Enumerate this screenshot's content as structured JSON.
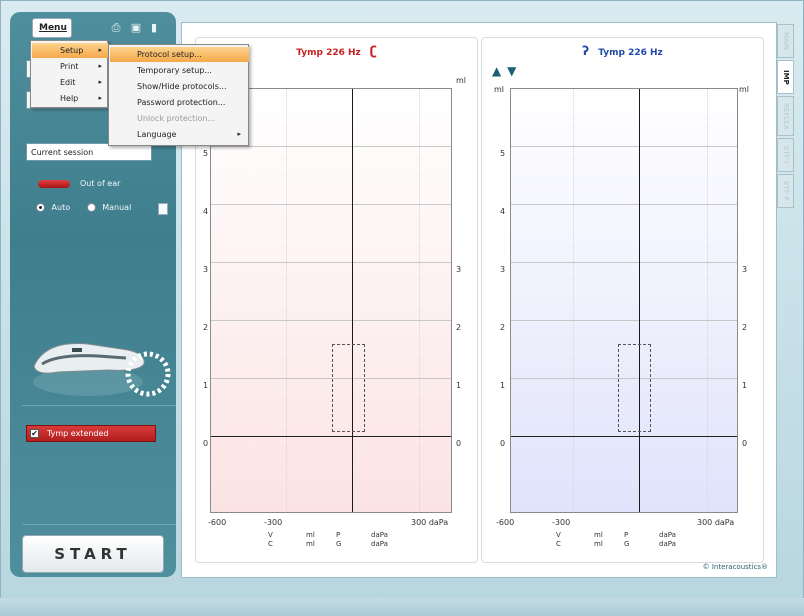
{
  "toolbar": {
    "menu_label": "Menu",
    "icons": [
      "printer-icon",
      "save-icon",
      "door-icon"
    ]
  },
  "menu": {
    "items": [
      {
        "label": "Setup",
        "has_submenu": true,
        "highlighted": true
      },
      {
        "label": "Print",
        "has_submenu": true
      },
      {
        "label": "Edit",
        "has_submenu": true
      },
      {
        "label": "Help",
        "has_submenu": true
      }
    ],
    "arrow": "▸"
  },
  "setup_submenu": {
    "items": [
      {
        "label": "Protocol setup...",
        "highlighted": true
      },
      {
        "label": "Temporary setup..."
      },
      {
        "label": "Show/Hide protocols..."
      },
      {
        "label": "Password protection..."
      },
      {
        "label": "Unlock protection...",
        "disabled": true
      },
      {
        "label": "Language",
        "has_submenu": true
      }
    ]
  },
  "session": {
    "current": "Current session"
  },
  "probe_status": {
    "label": "Out of ear",
    "color": "#c82020"
  },
  "mode": {
    "auto_label": "Auto",
    "manual_label": "Manual",
    "selected": "Auto"
  },
  "tymp_extended": {
    "label": "Tymp extended",
    "checked": true,
    "check_glyph": "✔"
  },
  "start_label": "START",
  "tabs": {
    "items": [
      {
        "label": "MAIN",
        "active": false
      },
      {
        "label": "IMP",
        "active": true
      },
      {
        "label": "REFLEX",
        "active": false
      },
      {
        "label": "ETF-I",
        "active": false
      },
      {
        "label": "ETF-P",
        "active": false
      }
    ]
  },
  "left_panel": {
    "title": "Tymp 226 Hz",
    "ear": "right",
    "ear_icon": "right-ear-icon",
    "ear_color": "#c82020",
    "unit": "ml",
    "y_ticks_left": [
      "5",
      "4",
      "3",
      "2",
      "1",
      "0"
    ],
    "y_ticks_right": [
      "3",
      "2",
      "1",
      "0"
    ],
    "x_ticks": [
      "-600",
      "-300",
      "300 daPa"
    ],
    "readout": {
      "r1": [
        "V",
        "ml",
        "P",
        "daPa"
      ],
      "r2": [
        "C",
        "ml",
        "G",
        "daPa"
      ]
    }
  },
  "right_panel": {
    "title": "Tymp 226 Hz",
    "ear": "left",
    "ear_icon": "left-ear-icon",
    "ear_color": "#1f4aa8",
    "unit": "ml",
    "y_ticks_left": [
      "5",
      "4",
      "3",
      "2",
      "1",
      "0"
    ],
    "y_ticks_right": [
      "3",
      "2",
      "1",
      "0"
    ],
    "x_ticks": [
      "-600",
      "-300",
      "300 daPa"
    ],
    "readout": {
      "r1": [
        "V",
        "ml",
        "P",
        "daPa"
      ],
      "r2": [
        "C",
        "ml",
        "G",
        "daPa"
      ]
    },
    "arrow_up": "▲",
    "arrow_down": "▼"
  },
  "footer": {
    "brand": "© Interacoustics®"
  }
}
